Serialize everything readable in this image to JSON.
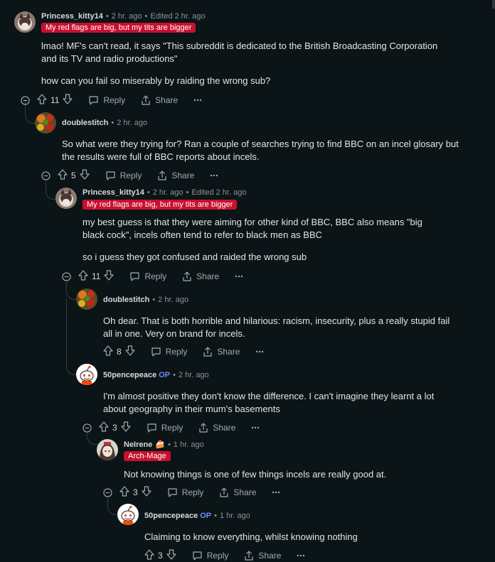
{
  "labels": {
    "reply": "Reply",
    "share": "Share"
  },
  "comments": [
    {
      "author": "Princess_kitty14",
      "op": "",
      "time": "2 hr. ago",
      "edited": "Edited 2 hr. ago",
      "flair": "My red flags are big, but my tits are bigger",
      "paragraphs": [
        "lmao! MF's can't read, it says \"This subreddit is dedicated to the British Broadcasting Corporation and its TV and radio productions\"",
        "how can you fail so miserably by raiding the wrong sub?"
      ],
      "votes": "11"
    },
    {
      "author": "doublestitch",
      "op": "",
      "time": "2 hr. ago",
      "paragraphs": [
        "So what were they trying for? Ran a couple of searches trying to find BBC on an incel glosary but the results were full of BBC reports about incels."
      ],
      "votes": "5"
    },
    {
      "author": "Princess_kitty14",
      "op": "",
      "time": "2 hr. ago",
      "edited": "Edited 2 hr. ago",
      "flair": "My red flags are big, but my tits are bigger",
      "paragraphs": [
        "my best guess is that they were aiming for other kind of BBC, BBC also means \"big black cock\", incels often tend to refer to black men as BBC",
        "so i guess they got confused and raided the wrong sub"
      ],
      "votes": "11"
    },
    {
      "author": "doublestitch",
      "op": "",
      "time": "2 hr. ago",
      "paragraphs": [
        "Oh dear. That is both horrible and hilarious: racism, insecurity, plus a really stupid fail all in one. Very on brand for incels."
      ],
      "votes": "8"
    },
    {
      "author": "50pencepeace",
      "op": "OP",
      "time": "2 hr. ago",
      "paragraphs": [
        "I'm almost positive they don't know the difference. I can't imagine they learnt a lot about geography in their mum's basements"
      ],
      "votes": "3"
    },
    {
      "author": "NeIrene",
      "op": "",
      "author_emoji": "🍰",
      "time": "1 hr. ago",
      "flair": "Arch-Mage",
      "paragraphs": [
        "Not knowing things is one of few things incels are really good at."
      ],
      "votes": "3"
    },
    {
      "author": "50pencepeace",
      "op": "OP",
      "time": "1 hr. ago",
      "paragraphs": [
        "Claiming to know everything, whilst knowing nothing"
      ],
      "votes": "3"
    }
  ],
  "colors": {
    "background": "#0b1416",
    "flair": "#c8102e",
    "op": "#6f8cff",
    "thread_line": "#343d40"
  },
  "icons": [
    "avatar-kitty",
    "avatar-tomatoes",
    "avatar-snoo",
    "avatar-anime",
    "upvote-icon",
    "downvote-icon",
    "reply-icon",
    "share-icon",
    "more-icon",
    "collapse-icon"
  ]
}
